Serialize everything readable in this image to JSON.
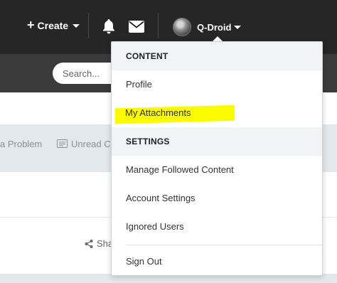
{
  "topbar": {
    "create_label": "Create",
    "user_name": "Q-Droid"
  },
  "search": {
    "placeholder": "Search..."
  },
  "toolbar": {
    "report_problem_partial": "a Problem",
    "unread_partial": "Unread Co"
  },
  "content": {
    "share_partial": "Sha"
  },
  "dropdown": {
    "sections": [
      {
        "header": "CONTENT",
        "items": [
          "Profile",
          "My Attachments"
        ]
      },
      {
        "header": "SETTINGS",
        "items": [
          "Manage Followed Content",
          "Account Settings",
          "Ignored Users"
        ]
      }
    ],
    "sign_out": "Sign Out",
    "highlight_color": "#fbfb00"
  }
}
